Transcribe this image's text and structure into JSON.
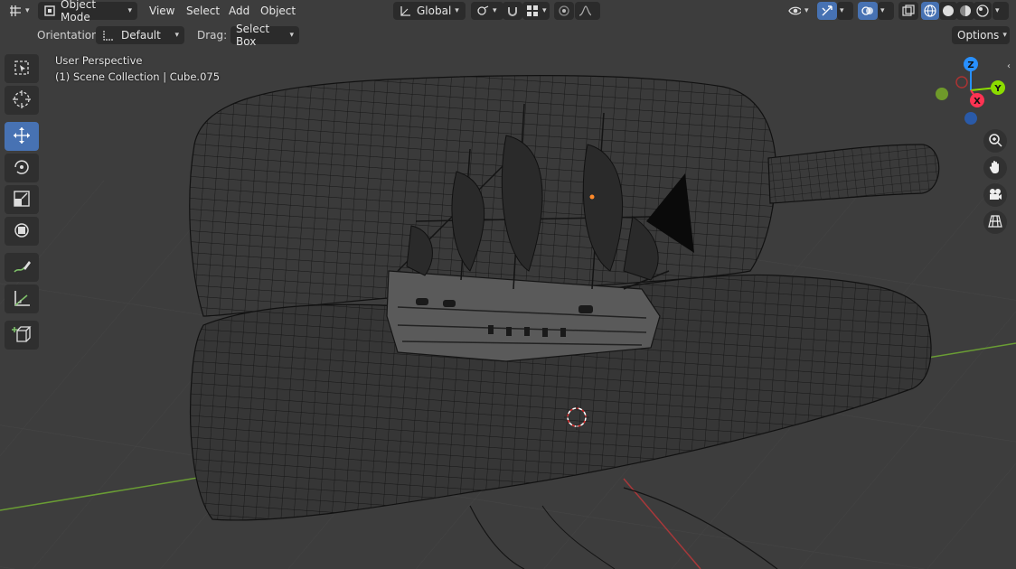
{
  "header": {
    "editor_type_icon": "grid-editor-icon",
    "mode_label": "Object Mode",
    "menus": [
      "View",
      "Select",
      "Add",
      "Object"
    ],
    "transform_orientation": "Global",
    "icons": {
      "pivot": "pivot-icon",
      "snap": "magnet-icon",
      "snap_target": "grid-snap-icon",
      "proportional": "proportional-edit-icon",
      "falloff": "falloff-curve-icon",
      "visibility": "eye-icon",
      "gizmos": "gizmo-icon",
      "overlays": "overlay-icon",
      "xray": "xray-icon",
      "shading_wire": "wireframe-shading-icon",
      "shading_solid": "solid-shading-icon",
      "shading_material": "material-shading-icon",
      "shading_rendered": "rendered-shading-icon"
    }
  },
  "toolsettings": {
    "orientation_label": "Orientation:",
    "orientation_value": "Default",
    "drag_label": "Drag:",
    "drag_value": "Select Box",
    "options_label": "Options"
  },
  "viewport": {
    "perspective_label": "User Perspective",
    "collection_label": "(1) Scene Collection | Cube.075"
  },
  "gizmo": {
    "axes": [
      "Z",
      "Y",
      "X"
    ],
    "colors": {
      "x": "#ff3352",
      "y": "#8bdc00",
      "z": "#2890ff"
    }
  },
  "tools": [
    "select-box-icon",
    "cursor-icon",
    "move-icon",
    "rotate-icon",
    "scale-icon",
    "transform-icon",
    "annotate-icon",
    "measure-icon",
    "add-cube-icon"
  ],
  "colors": {
    "accent": "#4772b3",
    "background": "#3d3d3d",
    "x_axis": "#ff3352",
    "y_axis": "#8bdc00"
  }
}
